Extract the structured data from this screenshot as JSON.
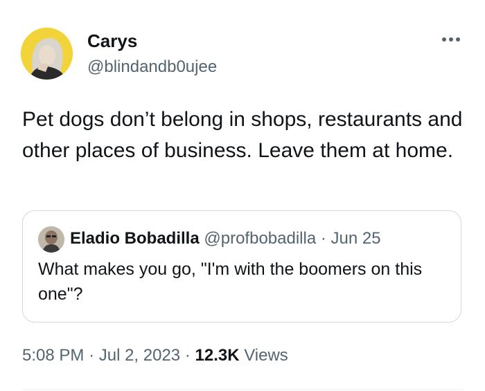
{
  "author": {
    "name": "Carys",
    "handle": "@blindandb0ujee",
    "avatar_color": "#f3d33a"
  },
  "more_icon": "more-horizontal-icon",
  "tweet": {
    "text": "Pet dogs don’t belong in shops, restaurants and other places of business. Leave them at home."
  },
  "quote": {
    "name": "Eladio Bobadilla",
    "handle": "@profbobadilla",
    "separator": "·",
    "date": "Jun 25",
    "text": "What makes you go, \"I'm with the boomers on this one\"?"
  },
  "meta": {
    "time": "5:08 PM",
    "separator": "·",
    "date": "Jul 2, 2023",
    "views_count": "12.3K",
    "views_label": "Views"
  }
}
